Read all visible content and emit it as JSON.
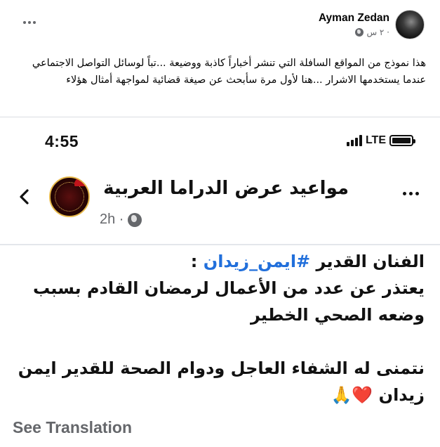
{
  "post": {
    "author": "Ayman Zedan",
    "time": "٢ س ·",
    "text": "هذا نموذج من المواقع السافلة التي تنشر أخباراً كاذبة ووضيعة ...تباً لوسائل التواصل الاجتماعي عندما يستخدمها الاشرار ...هنا لأول مرة سأبحث عن صيغة قضائية لمواجهة أمثال هؤلاء"
  },
  "phone": {
    "time": "4:55",
    "network": "LTE",
    "battery_level": 1.0
  },
  "inner_post": {
    "page_name": "مواعيد عرض الدراما العربية",
    "time": "2h ·",
    "line1_prefix": "الفنان القدير ",
    "hashtag": "#ايمن_زيدان",
    "line1_suffix": " :",
    "line2": "يعتذر عن عدد من الأعمال لرمضان القادم بسبب وضعه الصحي الخطير",
    "line3": "نتمنى له الشفاء العاجل ودوام الصحة للقدير ايمن زيدان",
    "emoji_heart": "❤️",
    "emoji_pray": "🙏",
    "see_translation": "See Translation"
  },
  "icons": {
    "more": "more-horizontal-icon",
    "globe": "globe-icon",
    "back": "chevron-left-icon"
  }
}
